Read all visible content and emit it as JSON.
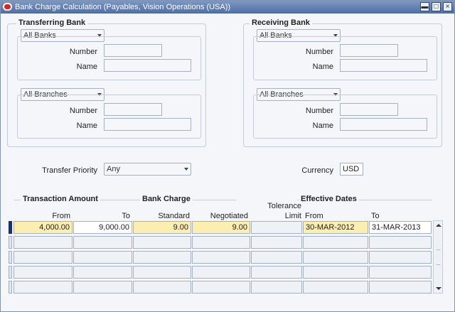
{
  "window": {
    "title": "Bank Charge Calculation (Payables, Vision Operations (USA))"
  },
  "transferring_bank": {
    "title": "Transferring Bank",
    "bank_select": "All Banks",
    "number_label": "Number",
    "number_value": "",
    "name_label": "Name",
    "name_value": "",
    "branch_select": "All Branches",
    "branch_number_label": "Number",
    "branch_number_value": "",
    "branch_name_label": "Name",
    "branch_name_value": ""
  },
  "receiving_bank": {
    "title": "Receiving Bank",
    "bank_select": "All Banks",
    "number_label": "Number",
    "number_value": "",
    "name_label": "Name",
    "name_value": "",
    "branch_select": "All Branches",
    "branch_number_label": "Number",
    "branch_number_value": "",
    "branch_name_label": "Name",
    "branch_name_value": ""
  },
  "transfer_priority": {
    "label": "Transfer Priority",
    "value": "Any"
  },
  "currency": {
    "label": "Currency",
    "value": "USD"
  },
  "table": {
    "groups": {
      "transaction_amount": "Transaction Amount",
      "bank_charge": "Bank Charge",
      "effective_dates": "Effective Dates"
    },
    "columns": {
      "from": "From",
      "to": "To",
      "standard": "Standard",
      "negotiated": "Negotiated",
      "tolerance_line1": "Tolerance",
      "tolerance_line2": "Limit",
      "date_from": "From",
      "date_to": "To"
    },
    "rows": [
      {
        "from": "4,000.00",
        "to": "9,000.00",
        "standard": "9.00",
        "negotiated": "9.00",
        "tolerance": "",
        "date_from": "30-MAR-2012",
        "date_to": "31-MAR-2013"
      },
      {
        "from": "",
        "to": "",
        "standard": "",
        "negotiated": "",
        "tolerance": "",
        "date_from": "",
        "date_to": ""
      },
      {
        "from": "",
        "to": "",
        "standard": "",
        "negotiated": "",
        "tolerance": "",
        "date_from": "",
        "date_to": ""
      },
      {
        "from": "",
        "to": "",
        "standard": "",
        "negotiated": "",
        "tolerance": "",
        "date_from": "",
        "date_to": ""
      },
      {
        "from": "",
        "to": "",
        "standard": "",
        "negotiated": "",
        "tolerance": "",
        "date_from": "",
        "date_to": ""
      }
    ]
  },
  "icons": {
    "window": "oracle-window-icon",
    "minimize": "minimize-icon",
    "maximize": "maximize-icon",
    "close": "close-icon"
  }
}
